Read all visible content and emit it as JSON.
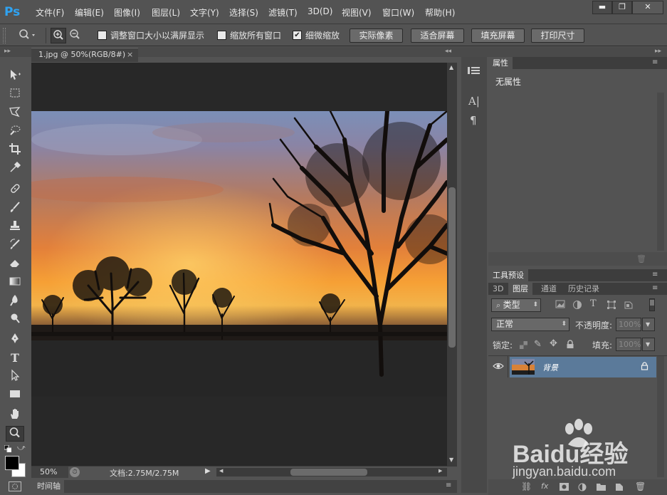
{
  "app": {
    "logo": "Ps"
  },
  "menu": [
    "文件(F)",
    "编辑(E)",
    "图像(I)",
    "图层(L)",
    "文字(Y)",
    "选择(S)",
    "滤镜(T)",
    "3D(D)",
    "视图(V)",
    "窗口(W)",
    "帮助(H)"
  ],
  "window_buttons": [
    "▬",
    "❐",
    "✕"
  ],
  "options": {
    "resize_windows": {
      "label": "调整窗口大小以满屏显示",
      "checked": false
    },
    "zoom_all": {
      "label": "缩放所有窗口",
      "checked": false
    },
    "scrubby_zoom": {
      "label": "细微缩放",
      "checked": true
    },
    "buttons": [
      "实际像素",
      "适合屏幕",
      "填充屏幕",
      "打印尺寸"
    ]
  },
  "document": {
    "tab_title": "1.jpg @ 50%(RGB/8#)",
    "tab_close": "×",
    "zoom": "50%",
    "doc_info": "文档:2.75M/2.75M",
    "timeline_label": "时间轴"
  },
  "properties_panel": {
    "tab": "属性",
    "content": "无属性"
  },
  "tool_presets_panel": {
    "tab": "工具预设"
  },
  "layers_panel": {
    "tabs": [
      "3D",
      "图层",
      "通道",
      "历史记录"
    ],
    "active_tab": "图层",
    "filter_kind": "类型",
    "blend_mode": "正常",
    "opacity_label": "不透明度:",
    "opacity_value": "100%",
    "lock_label": "锁定:",
    "fill_label": "填充:",
    "fill_value": "100%",
    "layers": [
      {
        "name": "背景",
        "visible": true,
        "locked": true
      }
    ]
  },
  "watermark": {
    "brand": "Baidu经验",
    "url": "jingyan.baidu.com"
  },
  "colors": {
    "accent_blue": "#2fa3f2",
    "ui_bg": "#535353",
    "canvas_bg": "#282828",
    "selected_layer": "#5b7a9a"
  }
}
